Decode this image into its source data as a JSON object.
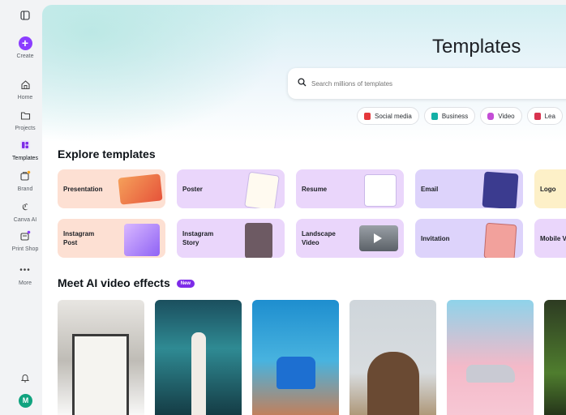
{
  "sidebar": {
    "items": [
      {
        "label": "Create",
        "icon": "plus-icon"
      },
      {
        "label": "Home",
        "icon": "home-icon"
      },
      {
        "label": "Projects",
        "icon": "folder-icon"
      },
      {
        "label": "Templates",
        "icon": "templates-icon"
      },
      {
        "label": "Brand",
        "icon": "brand-icon"
      },
      {
        "label": "Canva AI",
        "icon": "canva-ai-icon"
      },
      {
        "label": "Print Shop",
        "icon": "print-shop-icon"
      },
      {
        "label": "More",
        "icon": "more-icon"
      }
    ],
    "avatar_initial": "M",
    "active_item": "Templates"
  },
  "header": {
    "title": "Templates",
    "search_placeholder": "Search millions of templates"
  },
  "categories": [
    {
      "label": "Social media",
      "color": "#e5383b"
    },
    {
      "label": "Business",
      "color": "#13b0a6"
    },
    {
      "label": "Video",
      "color": "#c44dd6"
    },
    {
      "label": "Lea",
      "color": "#d8334f"
    }
  ],
  "explore": {
    "title": "Explore templates",
    "cards": [
      {
        "label": "Presentation",
        "color": "#fde0d3"
      },
      {
        "label": "Poster",
        "color": "#ead6fb"
      },
      {
        "label": "Resume",
        "color": "#ead6fb"
      },
      {
        "label": "Email",
        "color": "#ddd3fb"
      },
      {
        "label": "Logo",
        "color": "#fdf0c8"
      },
      {
        "label": "Instagram Post",
        "color": "#fde0d3"
      },
      {
        "label": "Instagram Story",
        "color": "#ead6fb"
      },
      {
        "label": "Landscape Video",
        "color": "#ead6fb"
      },
      {
        "label": "Invitation",
        "color": "#ddd3fb"
      },
      {
        "label": "Mobile V",
        "color": "#ead6fb"
      }
    ]
  },
  "ai_effects": {
    "title": "Meet AI video effects",
    "badge": "New"
  },
  "colors": {
    "accent": "#8b3dff",
    "badge": "#7d2ae8"
  }
}
